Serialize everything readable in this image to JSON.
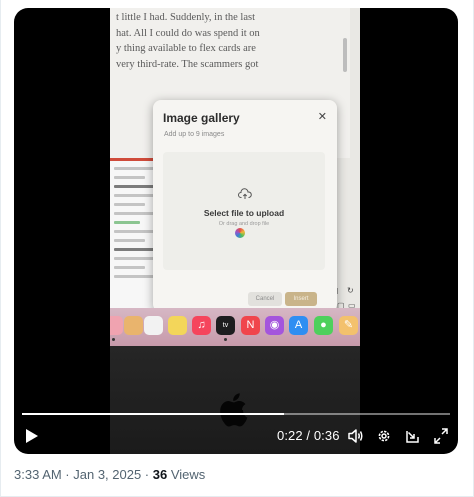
{
  "video": {
    "document_lines": [
      "t little I had. Suddenly, in the last",
      "hat. All I could do was spend it on",
      "y thing available to flex cards are",
      "very third-rate. The scammers got"
    ],
    "modal": {
      "title": "Image gallery",
      "subtitle": "Add up to 9 images",
      "close_glyph": "✕",
      "dropzone_title": "Select file to upload",
      "dropzone_hint": "Or drag and drop file",
      "cancel_label": "Cancel",
      "insert_label": "Insert"
    },
    "dock_apps": [
      {
        "icon": "notes-icon",
        "color": "#f6d86b"
      },
      {
        "icon": "reminders-icon",
        "color": "#f2f2f2"
      },
      {
        "icon": "notes-yellow-icon",
        "color": "#f3d65a"
      },
      {
        "icon": "music-icon",
        "color": "#f5455c"
      },
      {
        "icon": "apple-tv-icon",
        "color": "#1d1d1f"
      },
      {
        "icon": "news-icon",
        "color": "#f0454c"
      },
      {
        "icon": "podcasts-icon",
        "color": "#a455dc"
      },
      {
        "icon": "app-store-icon",
        "color": "#2f8ef2"
      },
      {
        "icon": "messages-icon",
        "color": "#4ed05c"
      },
      {
        "icon": "pages-icon",
        "color": "#f3c16d"
      }
    ]
  },
  "controls": {
    "time": "0:22 / 0:36",
    "progress": 0.6111,
    "accent": "#ffffff"
  },
  "meta": {
    "timestamp": "3:33 AM · Jan 3, 2025 · ",
    "views_count": "36",
    "views_label": " Views"
  }
}
